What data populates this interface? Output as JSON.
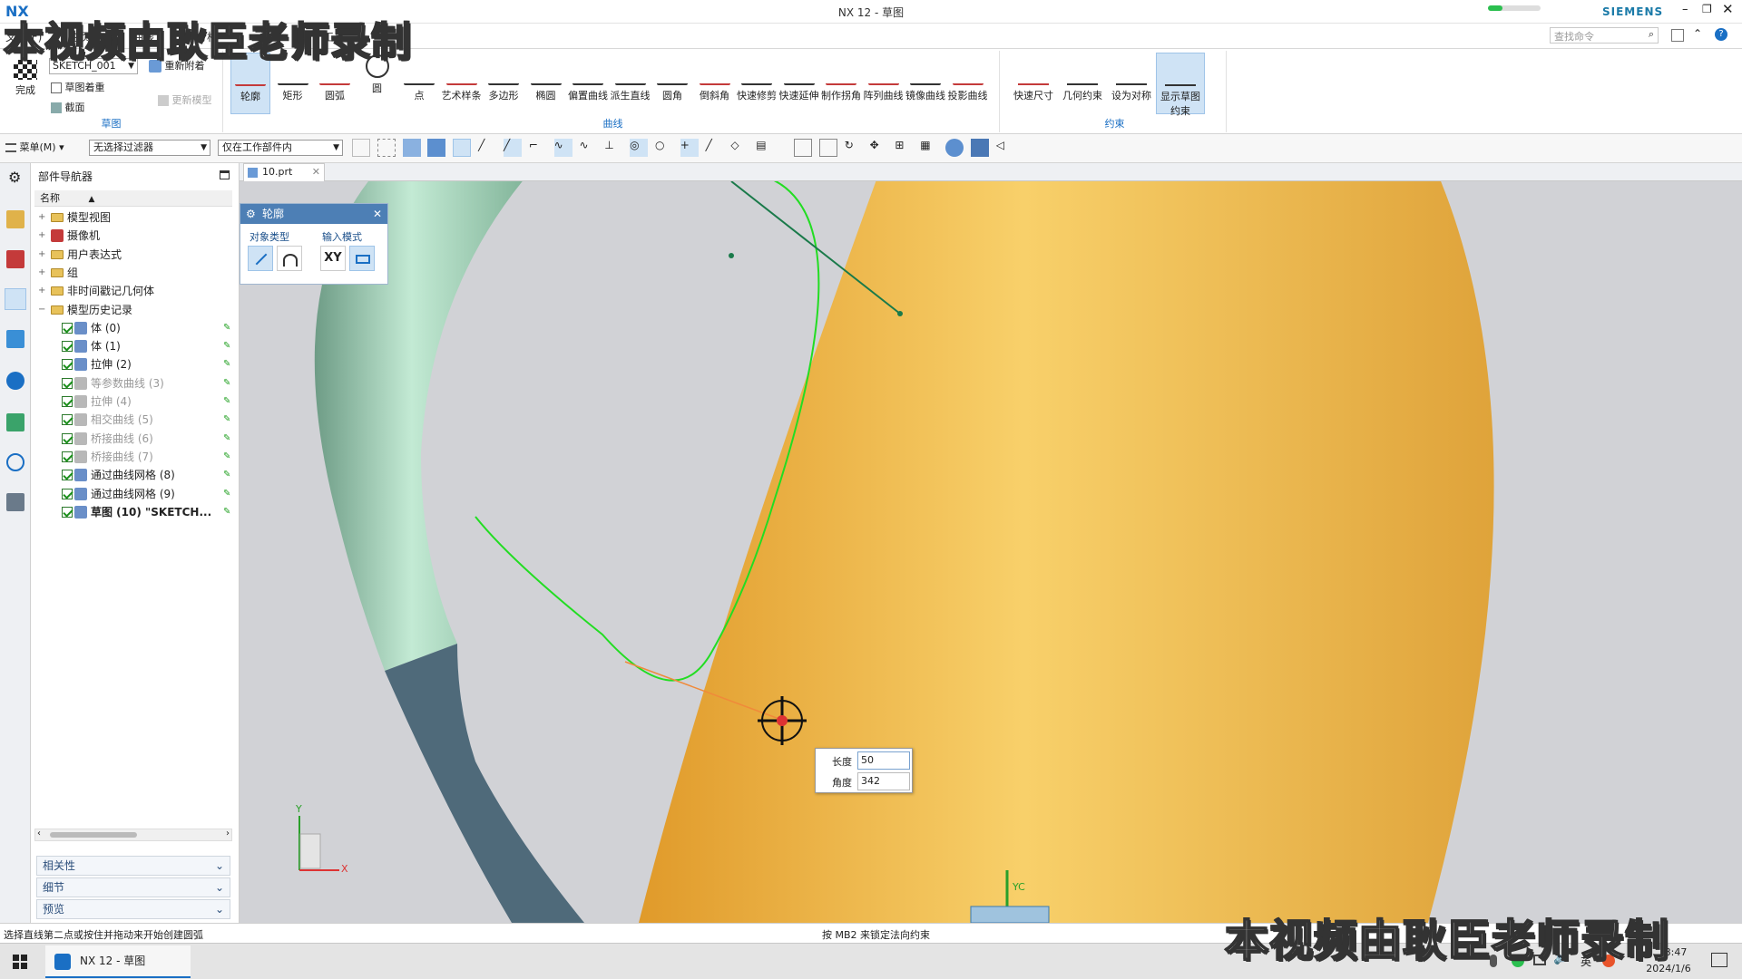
{
  "window": {
    "title": "NX 12 - 草图",
    "brand": "SIEMENS",
    "search_placeholder": "查找命令",
    "ribbon_group_sketch": "草图",
    "ribbon_group_curve": "曲线",
    "ribbon_group_constraint": "约束"
  },
  "watermark": {
    "text": "本视频由耿臣老师录制"
  },
  "ribbon_tabs": [
    "文件(F)",
    "主页",
    "曲线",
    "分析",
    "视图",
    "工具"
  ],
  "sketch_group": {
    "finish_label": "完成",
    "sketch_name": "SKETCH_001",
    "reattach_label": "重新附着",
    "orient_label": "草图着重",
    "section_label": "截面",
    "update_label": "更新模型"
  },
  "curve_tools": [
    "轮廓",
    "矩形",
    "圆弧",
    "圆",
    "点",
    "艺术样条",
    "多边形",
    "椭圆",
    "偏置曲线",
    "派生直线",
    "圆角",
    "倒斜角",
    "快速修剪",
    "快速延伸",
    "制作拐角",
    "阵列曲线",
    "镜像曲线",
    "投影曲线"
  ],
  "constraint_tools": [
    "快速尺寸",
    "几何约束",
    "设为对称",
    "显示草图约束"
  ],
  "toolbar2": {
    "menu_label": "菜单(M)",
    "filter_value": "无选择过滤器",
    "scope_value": "仅在工作部件内"
  },
  "navigator": {
    "title": "部件导航器",
    "column_name": "名称",
    "items": [
      {
        "label": "模型视图",
        "type": "folder",
        "indent": 0
      },
      {
        "label": "摄像机",
        "type": "camera",
        "indent": 0
      },
      {
        "label": "用户表达式",
        "type": "folder",
        "indent": 0
      },
      {
        "label": "组",
        "type": "folder",
        "indent": 0
      },
      {
        "label": "非时间戳记几何体",
        "type": "folder",
        "indent": 0
      },
      {
        "label": "模型历史记录",
        "type": "folder-open",
        "indent": 0
      },
      {
        "label": "体 (0)",
        "type": "feature",
        "indent": 1,
        "dim": false
      },
      {
        "label": "体 (1)",
        "type": "feature",
        "indent": 1,
        "dim": false
      },
      {
        "label": "拉伸 (2)",
        "type": "feature",
        "indent": 1,
        "dim": false
      },
      {
        "label": "等参数曲线 (3)",
        "type": "feature",
        "indent": 1,
        "dim": true
      },
      {
        "label": "拉伸 (4)",
        "type": "feature",
        "indent": 1,
        "dim": true
      },
      {
        "label": "相交曲线 (5)",
        "type": "feature",
        "indent": 1,
        "dim": true
      },
      {
        "label": "桥接曲线 (6)",
        "type": "feature",
        "indent": 1,
        "dim": true
      },
      {
        "label": "桥接曲线 (7)",
        "type": "feature",
        "indent": 1,
        "dim": true
      },
      {
        "label": "通过曲线网格 (8)",
        "type": "feature",
        "indent": 1,
        "dim": false
      },
      {
        "label": "通过曲线网格 (9)",
        "type": "feature",
        "indent": 1,
        "dim": false
      },
      {
        "label": "草图 (10) \"SKETCH...",
        "type": "feature",
        "indent": 1,
        "dim": false,
        "bold": true
      }
    ],
    "panels": [
      "相关性",
      "细节",
      "预览"
    ]
  },
  "doc_tab": {
    "label": "10.prt"
  },
  "profile_dialog": {
    "title": "轮廓",
    "object_type_label": "对象类型",
    "input_mode_label": "输入模式",
    "xy_label": "XY"
  },
  "dynamic_input": {
    "length_label": "长度",
    "length_value": "50",
    "angle_label": "角度",
    "angle_value": "342"
  },
  "viewport": {
    "axis_x": "X",
    "axis_y": "Y",
    "axis_yc": "YC"
  },
  "status": {
    "left": "选择直线第二点或按住并拖动来开始创建圆弧",
    "center": "按 MB2 来锁定法向约束"
  },
  "taskbar": {
    "app_label": "NX 12 - 草图",
    "ime": "英",
    "time": "8:47",
    "date": "2024/1/6"
  },
  "colors": {
    "accent": "#1a6fc4",
    "sketch_green": "#22dd22",
    "body_orange": "#f3b13a",
    "handle_green": "#9fd3b0"
  }
}
